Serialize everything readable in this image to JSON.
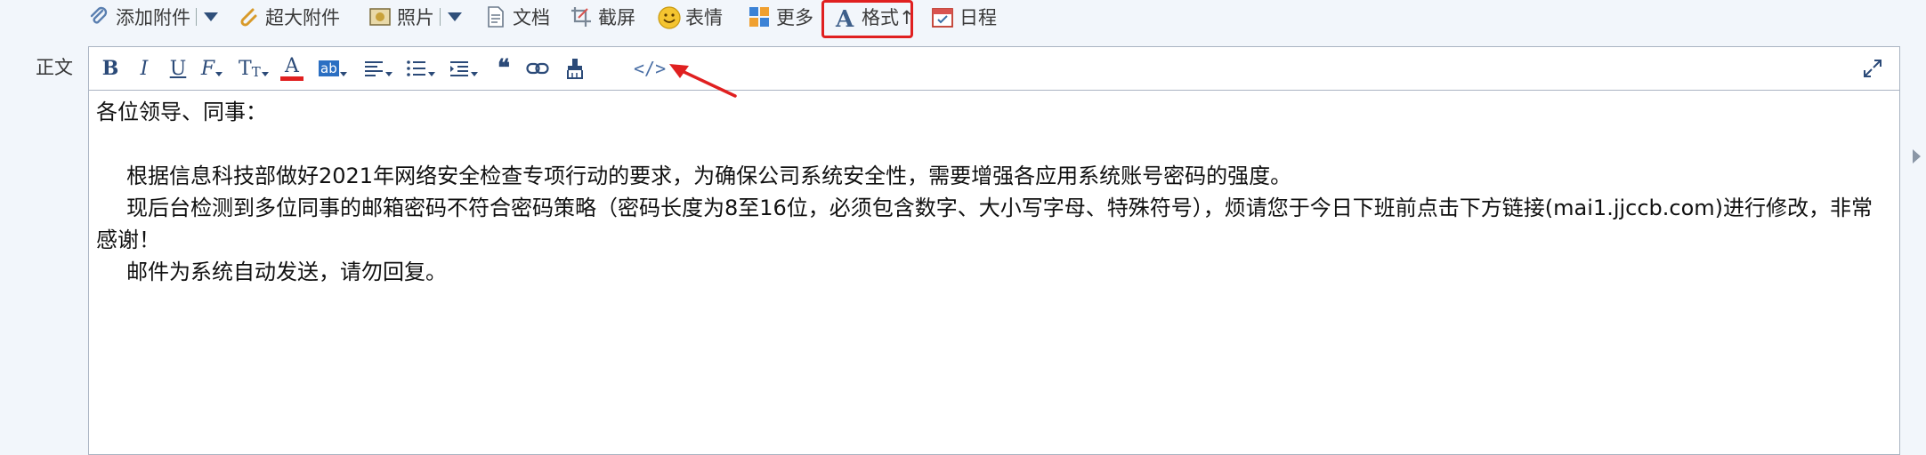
{
  "toolbar": {
    "add_attachment": "添加附件",
    "large_attachment": "超大附件",
    "photo": "照片",
    "document": "文档",
    "screenshot": "截屏",
    "emoji": "表情",
    "more": "更多",
    "format": "格式↑",
    "schedule": "日程"
  },
  "body_label": "正文",
  "format_toolbar": {
    "bold": "B",
    "italic": "I",
    "underline": "U",
    "clear_format": "F",
    "font_size": "T",
    "font_color": "A",
    "highlight": "ab",
    "code": "</>"
  },
  "content": {
    "greeting": "各位领导、同事：",
    "para1": "根据信息科技部做好2021年网络安全检查专项行动的要求，为确保公司系统安全性，需要增强各应用系统账号密码的强度。",
    "para2": "现后台检测到多位同事的邮箱密码不符合密码策略（密码长度为8至16位，必须包含数字、大小写字母、特殊符号），烦请您于今日下班前点击下方链接(mai1.jjccb.com)进行修改，非常感谢！",
    "para3": "邮件为系统自动发送，请勿回复。"
  },
  "colors": {
    "highlight_red": "#e02020",
    "icon_blue": "#2b4a78"
  }
}
